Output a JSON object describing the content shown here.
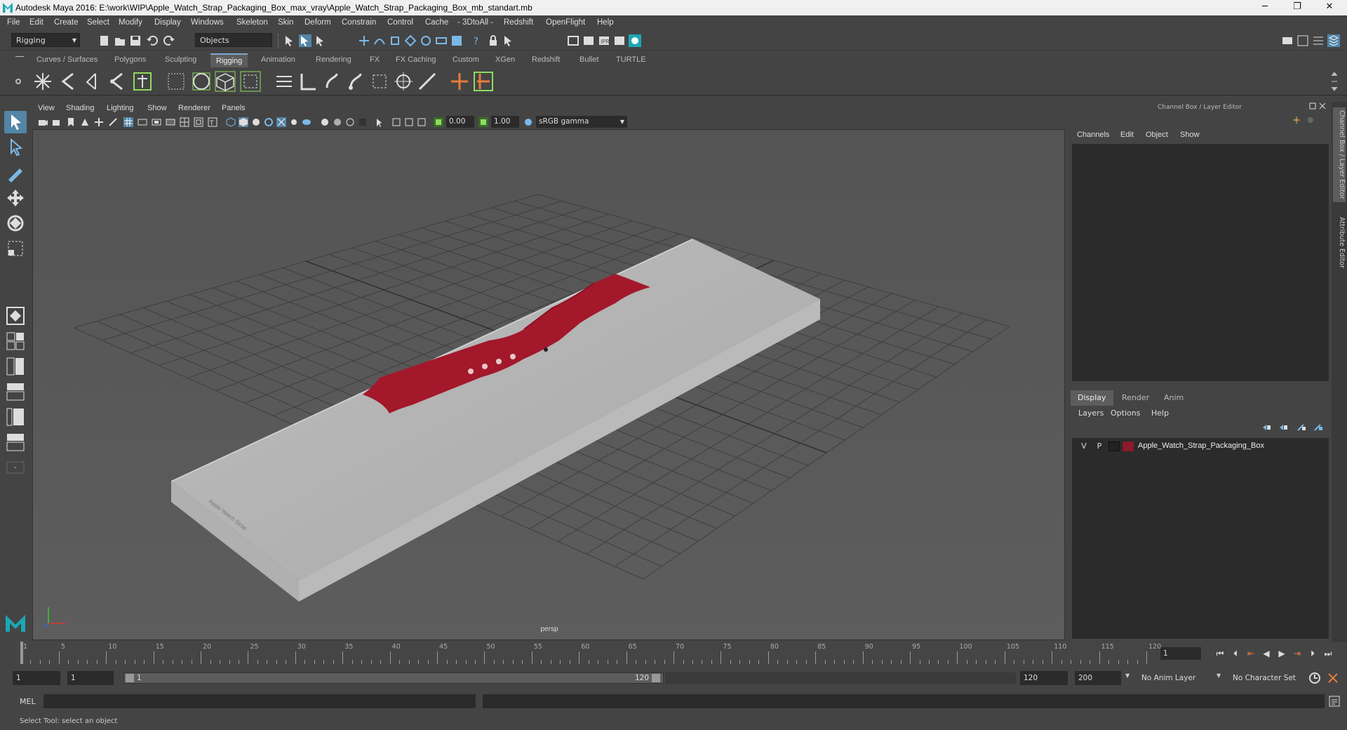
{
  "window": {
    "title": "Autodesk Maya 2016: E:\\work\\WIP\\Apple_Watch_Strap_Packaging_Box_max_vray\\Apple_Watch_Strap_Packaging_Box_mb_standart.mb",
    "min": "─",
    "restore": "❐",
    "close": "✕"
  },
  "menubar": [
    "File",
    "Edit",
    "Create",
    "Select",
    "Modify",
    "Display",
    "Windows",
    "Skeleton",
    "Skin",
    "Deform",
    "Constrain",
    "Control",
    "Cache",
    "- 3DtoAll -",
    "Redshift",
    "OpenFlight",
    "Help"
  ],
  "status": {
    "menu_set": "Rigging",
    "selection_mode": "Objects"
  },
  "shelf_tabs": [
    "Curves / Surfaces",
    "Polygons",
    "Sculpting",
    "Rigging",
    "Animation",
    "Rendering",
    "FX",
    "FX Caching",
    "Custom",
    "XGen",
    "Redshift",
    "Bullet",
    "TURTLE"
  ],
  "active_shelf": "Rigging",
  "viewport": {
    "menu": [
      "View",
      "Shading",
      "Lighting",
      "Show",
      "Renderer",
      "Panels"
    ],
    "exposure": "0.00",
    "gamma": "1.00",
    "color_space": "sRGB gamma",
    "camera": "persp",
    "box_print": "Apple Watch Strap"
  },
  "right_panel": {
    "title": "Channel Box / Layer Editor",
    "channel_menu": [
      "Channels",
      "Edit",
      "Object",
      "Show"
    ],
    "layer_tabs": [
      "Display",
      "Render",
      "Anim"
    ],
    "active_layer_tab": "Display",
    "layer_menu": [
      "Layers",
      "Options",
      "Help"
    ],
    "layer": {
      "v": "V",
      "p": "P",
      "color": "#8b1a2b",
      "name": "Apple_Watch_Strap_Packaging_Box"
    },
    "vtabs": [
      "Channel Box / Layer Editor",
      "Attribute Editor"
    ]
  },
  "timeline": {
    "ticks": [
      "1",
      "5",
      "10",
      "15",
      "20",
      "25",
      "30",
      "35",
      "40",
      "45",
      "50",
      "55",
      "60",
      "65",
      "70",
      "75",
      "80",
      "85",
      "90",
      "95",
      "100",
      "105",
      "110",
      "115",
      "120"
    ],
    "current_frame": "1"
  },
  "range": {
    "start": "1",
    "playback_start": "1",
    "slider_start": "1",
    "slider_end": "120",
    "playback_end": "120",
    "end": "200",
    "anim_layer": "No Anim Layer",
    "char_set": "No Character Set"
  },
  "cmd": {
    "label": "MEL"
  },
  "help_line": "Select Tool: select an object",
  "colors": {
    "accent": "#5285a6",
    "strap": "#a3182b"
  }
}
